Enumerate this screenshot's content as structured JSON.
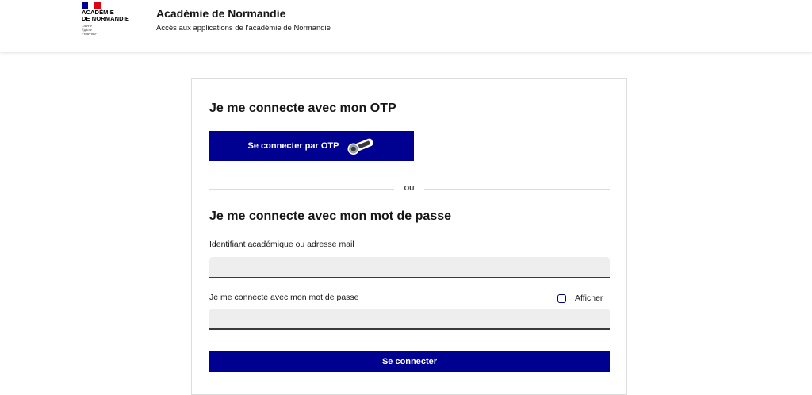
{
  "colors": {
    "primary": "#000091",
    "flag_blue": "#000091",
    "flag_white": "#ffffff",
    "flag_red": "#e1000f",
    "input_bg": "#eeeeee"
  },
  "header": {
    "logo": {
      "name": "ACADÉMIE\nDE NORMANDIE",
      "motto": "Liberté\nÉgalité\nFraternité"
    },
    "title": "Académie de Normandie",
    "subtitle": "Accès aux applications de l'académie de Normandie"
  },
  "otp_section": {
    "title": "Je me connecte avec mon OTP",
    "button_label": "Se connecter par OTP",
    "icon": "otp-token-icon"
  },
  "separator": {
    "text": "OU"
  },
  "password_section": {
    "title": "Je me connecte avec mon mot de passe",
    "identifier_label": "Identifiant académique ou adresse mail",
    "identifier_value": "",
    "password_label": "Je me connecte avec mon mot de passe",
    "password_value": "",
    "show_password_label": "Afficher",
    "submit_label": "Se connecter"
  }
}
